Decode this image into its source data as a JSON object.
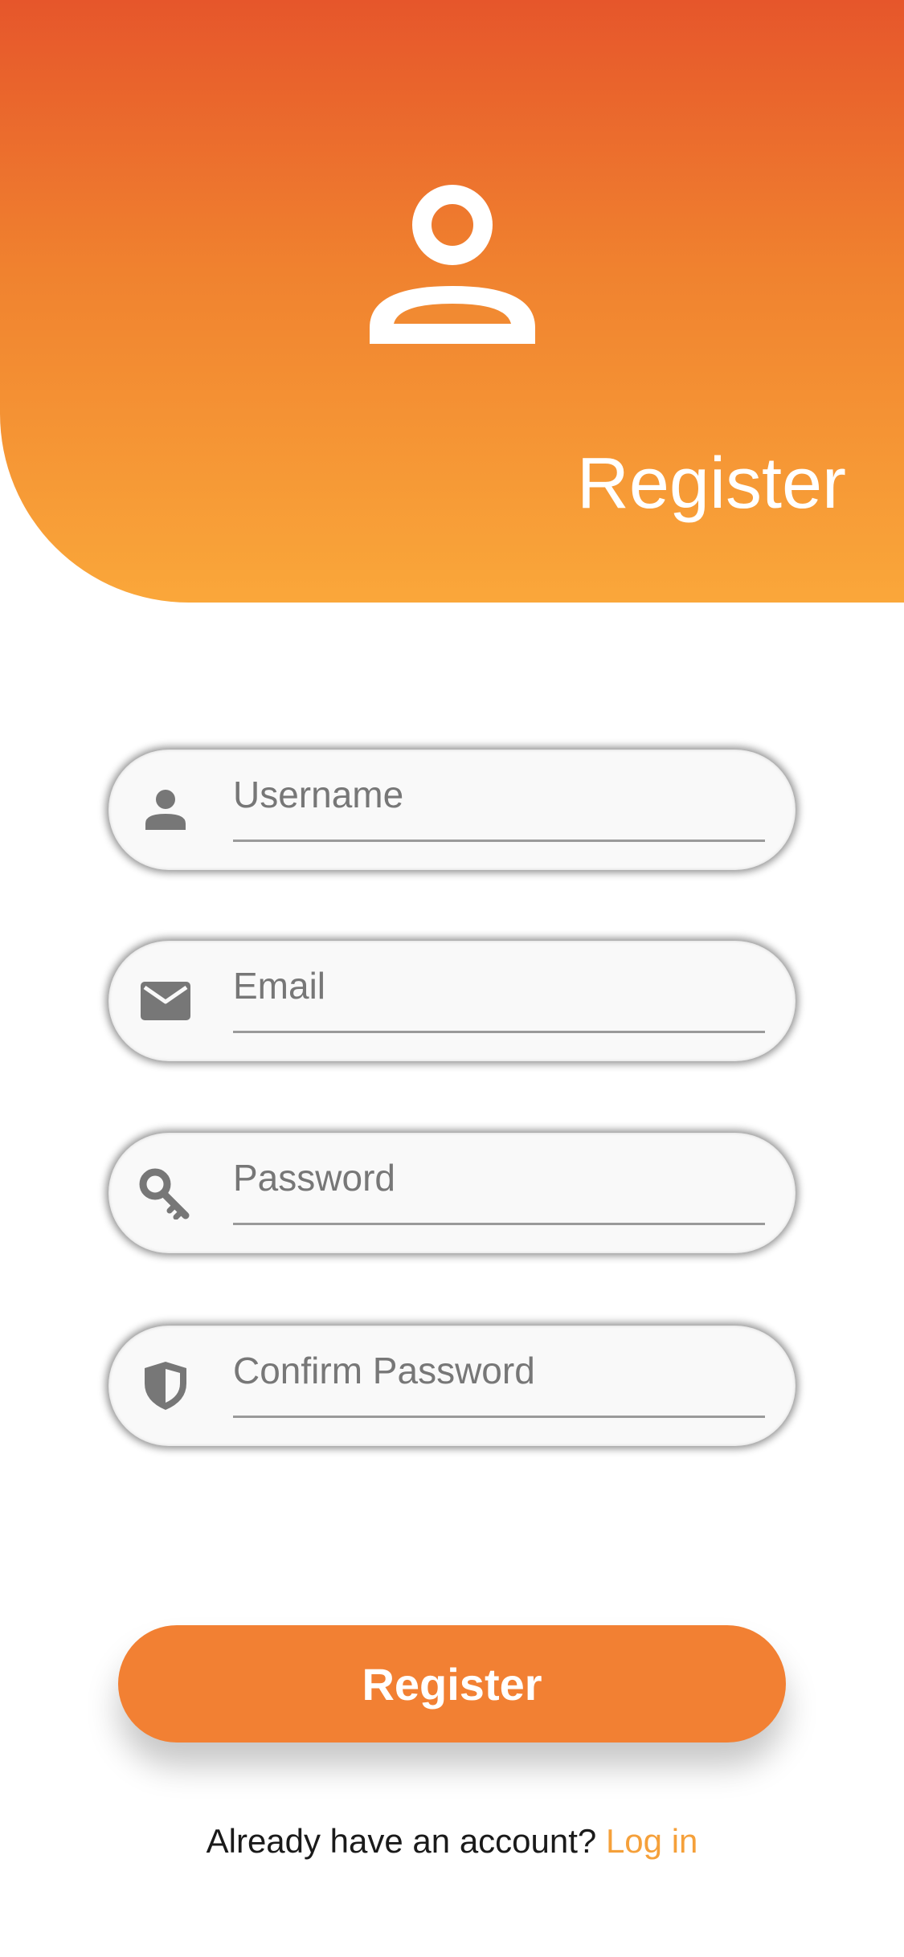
{
  "header": {
    "title": "Register",
    "icon": "person-outline-icon"
  },
  "fields": [
    {
      "icon": "person-icon",
      "placeholder": "Username",
      "value": ""
    },
    {
      "icon": "mail-icon",
      "placeholder": "Email",
      "value": ""
    },
    {
      "icon": "key-icon",
      "placeholder": "Password",
      "value": ""
    },
    {
      "icon": "shield-icon",
      "placeholder": "Confirm Password",
      "value": ""
    }
  ],
  "actions": {
    "register_label": "Register",
    "login_prompt": "Already have an account?",
    "login_link": "Log in"
  },
  "colors": {
    "gradient_top": "#e6562b",
    "gradient_bottom": "#faa73a",
    "button": "#f28033",
    "link": "#f5a03a",
    "icon": "#777777"
  }
}
